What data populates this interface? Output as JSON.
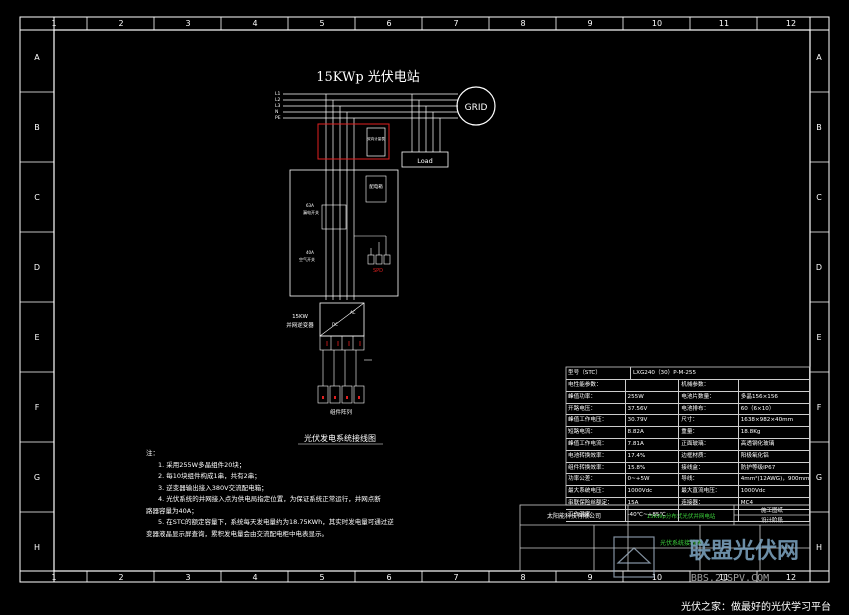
{
  "frame": {
    "columns": [
      "1",
      "2",
      "3",
      "4",
      "5",
      "6",
      "7",
      "8",
      "9",
      "10",
      "11",
      "12"
    ],
    "rows": [
      "A",
      "B",
      "C",
      "D",
      "E",
      "F",
      "G",
      "H"
    ]
  },
  "diagram": {
    "title": "15KWp 光伏电站",
    "grid_label": "GRID",
    "bus_labels": [
      "L1",
      "L2",
      "L3",
      "N",
      "PE"
    ],
    "meter_label": "双向计量表",
    "load_label": "Load",
    "distribution_box_label": "配电箱",
    "breaker1_label": "63A",
    "breaker1_sub": "漏电开关",
    "breaker2_label": "40A",
    "breaker2_sub": "空气开关",
    "spd_label": "SPD",
    "inverter_label_1": "15KW",
    "inverter_label_2": "并网逆变器",
    "inverter_dc": "DC",
    "inverter_ac": "AC",
    "array_label": "组件阵列",
    "diagram_caption": "光伏发电系统接线图"
  },
  "notes": {
    "heading": "注：",
    "lines": [
      "1.  采用255W多晶组件20块；",
      "2.  每10块组件构成1串，共有2串；",
      "3.  逆变器输出接入380V交流配电箱；",
      "4.  光伏系统的并网接入点为供电局指定位置，为保证系统正常运行，并网点断",
      "路器容量为40A；",
      "5.  在STC的额定容量下，系统每天发电量约为18.75KWh，其实时发电量可通过逆",
      "变器液晶显示屏查询，累积发电量会由交流配电柜中电表显示。"
    ]
  },
  "spec_table": {
    "header_left": "型号（STC）",
    "header_right": "LXG240（30）P-M-255",
    "rows": [
      [
        "电性能参数：",
        "",
        "机械参数：",
        ""
      ],
      [
        "峰值功率：",
        "255W",
        "电池片数量：",
        "多晶156×156"
      ],
      [
        "开路电压：",
        "37.56V",
        "电池排布：",
        "60（6×10）"
      ],
      [
        "峰值工作电压：",
        "30.79V",
        "尺寸：",
        "1638×982×40mm"
      ],
      [
        "短路电流：",
        "8.82A",
        "重量：",
        "18.8Kg"
      ],
      [
        "峰值工作电流：",
        "7.81A",
        "正面玻璃：",
        "高透钢化玻璃"
      ],
      [
        "电池转换效率：",
        "17.4%",
        "边框材质：",
        "阳极氧化铝"
      ],
      [
        "组件转换效率：",
        "15.8%",
        "接线盒：",
        "防护等级IP67"
      ],
      [
        "功率公差：",
        "0~+5W",
        "导线：",
        "4mm²(12AWG)，900mm"
      ],
      [
        "最大系统电压：",
        "1000Vdc",
        "最大直流电压：",
        "1000Vdc"
      ],
      [
        "串联保险丝额定：",
        "15A",
        "连接器：",
        "MC4"
      ],
      [
        "工作温度：",
        "-40℃~+85℃",
        "",
        ""
      ]
    ]
  },
  "title_block": {
    "company": "太阳能科技有限公司",
    "project": "15KWp分布式光伏并网电站",
    "stage": "施工图纸",
    "stage2": "设计阶段",
    "drawing_name": "光伏系统接线图"
  },
  "watermark": {
    "logo_text": "联盟光伏网",
    "url": "BBS.21SPV.COM",
    "slogan": "光伏之家：做最好的光伏学习平台"
  }
}
